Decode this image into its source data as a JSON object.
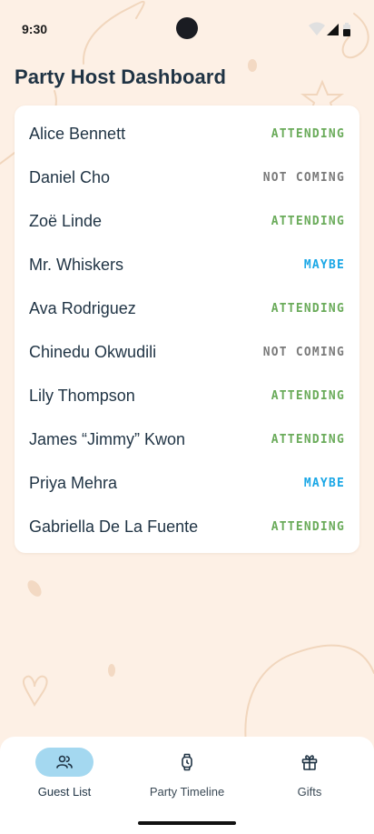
{
  "status_bar": {
    "time": "9:30",
    "icons": [
      "wifi-icon",
      "signal-icon",
      "battery-icon"
    ]
  },
  "header": {
    "title": "Party Host Dashboard"
  },
  "guests": [
    {
      "name": "Alice Bennett",
      "status": "ATTENDING",
      "status_key": "attending"
    },
    {
      "name": "Daniel Cho",
      "status": "NOT COMING",
      "status_key": "notcoming"
    },
    {
      "name": "Zoë Linde",
      "status": "ATTENDING",
      "status_key": "attending"
    },
    {
      "name": "Mr. Whiskers",
      "status": "MAYBE",
      "status_key": "maybe"
    },
    {
      "name": "Ava Rodriguez",
      "status": "ATTENDING",
      "status_key": "attending"
    },
    {
      "name": "Chinedu Okwudili",
      "status": "NOT COMING",
      "status_key": "notcoming"
    },
    {
      "name": "Lily Thompson",
      "status": "ATTENDING",
      "status_key": "attending"
    },
    {
      "name": "James “Jimmy” Kwon",
      "status": "ATTENDING",
      "status_key": "attending"
    },
    {
      "name": "Priya Mehra",
      "status": "MAYBE",
      "status_key": "maybe"
    },
    {
      "name": "Gabriella De La Fuente",
      "status": "ATTENDING",
      "status_key": "attending"
    }
  ],
  "colors": {
    "background": "#fdf0e5",
    "attending": "#6aab5a",
    "not_coming": "#7a7a7a",
    "maybe": "#1aa7e6",
    "active_nav": "#a4d8f0"
  },
  "bottom_nav": {
    "items": [
      {
        "label": "Guest List",
        "icon": "people-icon",
        "active": true
      },
      {
        "label": "Party Timeline",
        "icon": "watch-icon",
        "active": false
      },
      {
        "label": "Gifts",
        "icon": "gift-icon",
        "active": false
      }
    ]
  }
}
